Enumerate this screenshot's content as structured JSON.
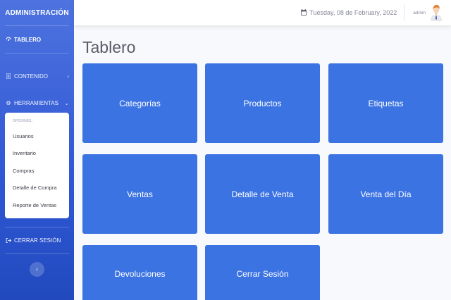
{
  "sidebar": {
    "brand": "ADMINISTRACIÓN",
    "items": [
      {
        "label": "TABLERO",
        "icon": "dashboard-icon"
      },
      {
        "label": "CONTENIDO",
        "icon": "document-icon",
        "arrow": "chevron-right-icon"
      },
      {
        "label": "HERRAMIENTAS",
        "icon": "gear-icon",
        "arrow": "chevron-down-icon"
      }
    ],
    "submenu": {
      "header": "OPCIONES:",
      "items": [
        "Usuarios",
        "Inventario",
        "Compras",
        "Detalle de Compra",
        "Reporte de Ventas"
      ]
    },
    "logout": {
      "label": "CERRAR SESIÓN",
      "icon": "logout-icon"
    },
    "toggle_icon": "chevron-left-icon"
  },
  "topbar": {
    "date": "Tuesday, 08 de February, 2022",
    "date_icon": "calendar-icon",
    "user_name": "admin",
    "avatar_icon": "user-avatar-icon"
  },
  "main": {
    "title": "Tablero",
    "tiles": [
      "Categorías",
      "Productos",
      "Etiquetas",
      "Ventas",
      "Detalle de Venta",
      "Venta del Día",
      "Devoluciones",
      "Cerrar Sesión"
    ]
  },
  "colors": {
    "sidebar": "#4e73df",
    "tile": "#3b73e3",
    "background": "#f8f9fc"
  }
}
